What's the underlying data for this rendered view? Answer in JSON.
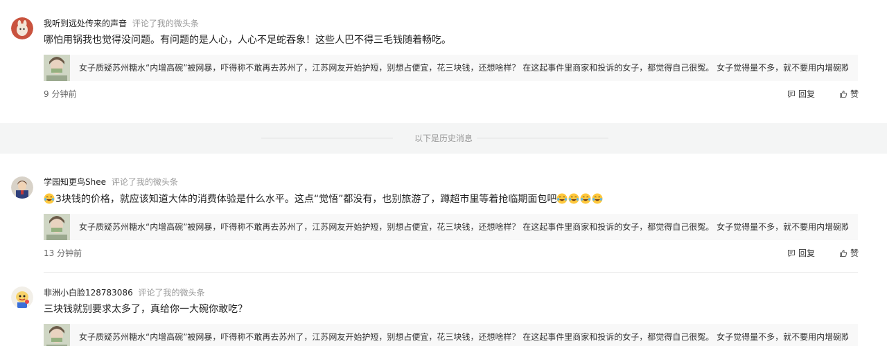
{
  "comments": [
    {
      "user": "我听到远处传来的声音",
      "action": "评论了我的微头条",
      "text": "哪怕用锅我也觉得没问题。有问题的是人心，人心不足蛇吞象！这些人巴不得三毛钱随着畅吃。",
      "quote": "女子质疑苏州糖水“内增高碗”被网暴，吓得称不敢再去苏州了，江苏网友开始护短，别想占便宜，花三块钱，还想啥样？ 在这起事件里商家和投诉的女子，都觉得自己很冤。 女子觉得量不多，就不要用内增碗欺骗消...",
      "time": "9 分钟前",
      "reply": "回复",
      "like": "赞"
    },
    {
      "user": "学园知更鸟Shee",
      "action": "评论了我的微头条",
      "text_lead": "3块钱的价格，就应该知道大体的消费体验是什么水平。这点“觉悟”都没有，也别旅游了，蹲超市里等着抢临期面包吧",
      "quote": "女子质疑苏州糖水“内增高碗”被网暴，吓得称不敢再去苏州了，江苏网友开始护短，别想占便宜，花三块钱，还想啥样？ 在这起事件里商家和投诉的女子，都觉得自己很冤。 女子觉得量不多，就不要用内增碗欺骗消...",
      "time": "13 分钟前",
      "reply": "回复",
      "like": "赞"
    },
    {
      "user": "非洲小白脸128783086",
      "action": "评论了我的微头条",
      "text": "三块钱就别要求太多了，真给你一大碗你敢吃？",
      "quote": "女子质疑苏州糖水“内增高碗”被网暴，吓得称不敢再去苏州了，江苏网友开始护短，别想占便宜，花三块钱，还想啥样？ 在这起事件里商家和投诉的女子，都觉得自己很冤。 女子觉得量不多，就不要用内增碗欺骗消..."
    }
  ],
  "divider": {
    "label": "以下是历史消息"
  },
  "icons": {
    "reply": "comment-icon",
    "like": "thumbs-up-icon",
    "emoji": "laughing-tears-emoji"
  },
  "colors": {
    "divider_band": "#f4f5f5",
    "quote_bg": "#f8f8f8",
    "muted": "#999999"
  }
}
